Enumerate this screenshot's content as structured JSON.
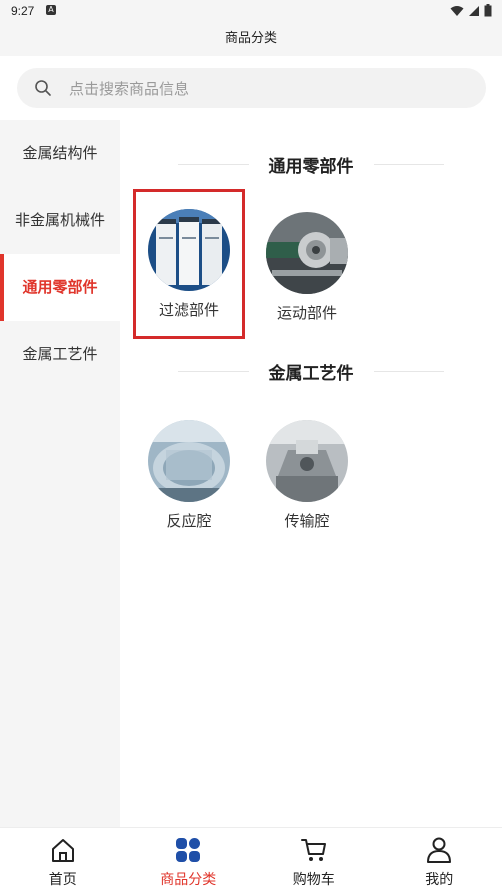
{
  "status_bar": {
    "time": "9:27",
    "notification": "A"
  },
  "header": {
    "title": "商品分类"
  },
  "search": {
    "placeholder": "点击搜索商品信息",
    "icon": "search-icon"
  },
  "sidebar": {
    "items": [
      {
        "label": "金属结构件",
        "active": false
      },
      {
        "label": "非金属机械件",
        "active": false
      },
      {
        "label": "通用零部件",
        "active": true
      },
      {
        "label": "金属工艺件",
        "active": false
      }
    ]
  },
  "sections": [
    {
      "title": "通用零部件",
      "items": [
        {
          "label": "过滤部件",
          "highlighted": true
        },
        {
          "label": "运动部件",
          "highlighted": false
        }
      ]
    },
    {
      "title": "金属工艺件",
      "items": [
        {
          "label": "反应腔",
          "highlighted": false
        },
        {
          "label": "传输腔",
          "highlighted": false
        }
      ]
    }
  ],
  "tabbar": {
    "tabs": [
      {
        "label": "首页",
        "icon": "home-icon",
        "active": false
      },
      {
        "label": "商品分类",
        "icon": "category-icon",
        "active": true
      },
      {
        "label": "购物车",
        "icon": "cart-icon",
        "active": false
      },
      {
        "label": "我的",
        "icon": "user-icon",
        "active": false
      }
    ]
  },
  "colors": {
    "accent": "#e0352b",
    "active_tab_icon": "#1f4fa8",
    "highlight_border": "#d42a2a"
  }
}
